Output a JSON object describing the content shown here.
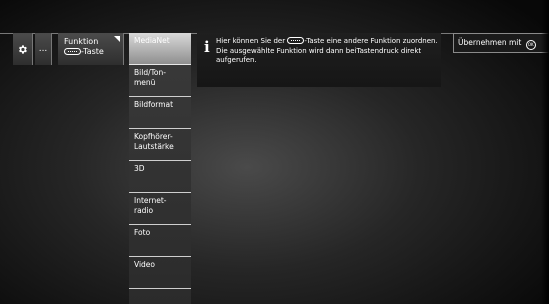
{
  "toolbar": {
    "more_label": "...",
    "function_line1": "Funktion",
    "function_line2": "-Taste",
    "icons": {
      "settings": "gear-icon",
      "key": "key-icon",
      "ok": "ok-icon"
    }
  },
  "menu": {
    "items": [
      {
        "label": "MediaNet",
        "selected": true
      },
      {
        "label": "Bild/Ton-\nmenü",
        "selected": false
      },
      {
        "label": "Bildformat",
        "selected": false
      },
      {
        "label": "Kopfhörer-\nLautstärke",
        "selected": false
      },
      {
        "label": "3D",
        "selected": false
      },
      {
        "label": "Internet-\nradio",
        "selected": false
      },
      {
        "label": "Foto",
        "selected": false
      },
      {
        "label": "Video",
        "selected": false
      }
    ]
  },
  "info": {
    "text_before_key": "Hier können Sie der",
    "text_after_key": "-Taste eine andere Funktion zuordnen. Die ausgewählte Funktion wird dann beiTastendruck direkt aufgerufen."
  },
  "apply_button": {
    "label": "Übernehmen mit"
  }
}
